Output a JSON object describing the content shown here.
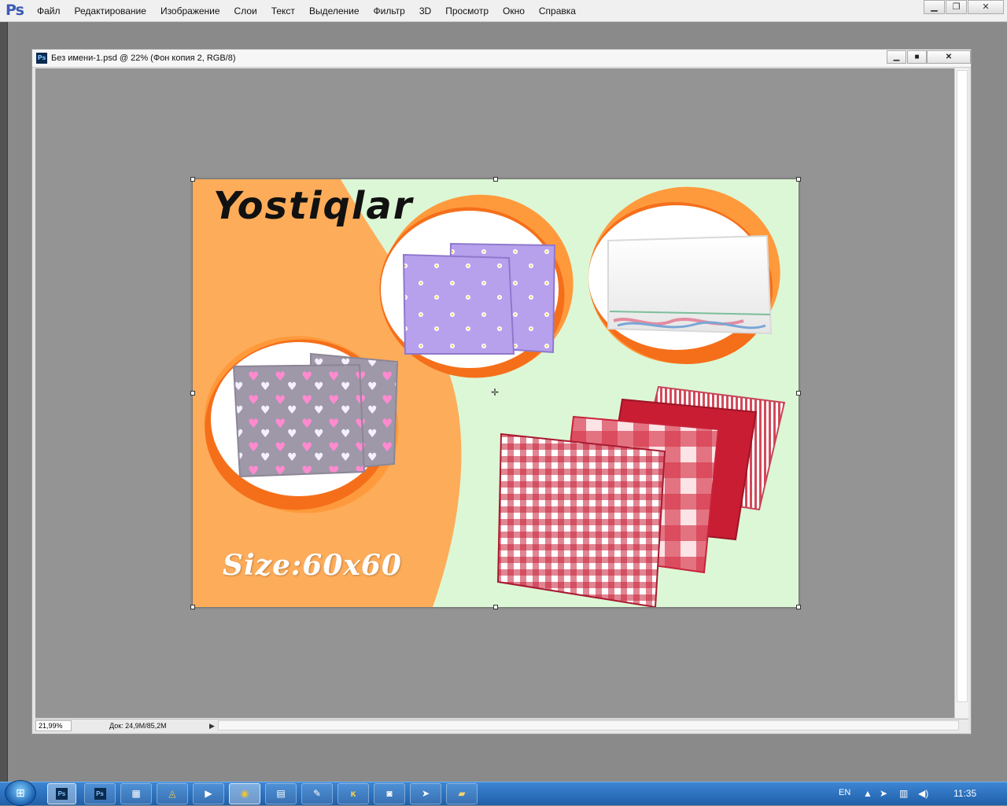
{
  "app": {
    "logo": "Ps",
    "menu": [
      "Файл",
      "Редактирование",
      "Изображение",
      "Слои",
      "Текст",
      "Выделение",
      "Фильтр",
      "3D",
      "Просмотр",
      "Окно",
      "Справка"
    ]
  },
  "document": {
    "icon": "Ps",
    "title": "Без имени-1.psd @ 22% (Фон копия 2, RGB/8)",
    "zoom": "21,99%",
    "doc_info": "Док: 24,9M/85,2M"
  },
  "artwork": {
    "title": "Yostiqlar",
    "size_text": "Size:60x60",
    "colors": {
      "left_bg": "#fdac5a",
      "right_bg": "#dcf7d6",
      "frame_dark": "#f56f1a",
      "frame_light": "#ff9a3c",
      "purple_pillow": "#b8a1ec",
      "gray_pillow": "#9e98a8",
      "red_pillow": "#c81d33"
    }
  },
  "taskbar": {
    "language": "EN",
    "clock": "11:35",
    "buttons": [
      {
        "name": "photoshop-active",
        "icon": "Ps"
      },
      {
        "name": "photoshop-2",
        "icon": "Ps"
      },
      {
        "name": "calculator",
        "icon": "calculator-icon"
      },
      {
        "name": "app-triangle",
        "icon": "triangle-icon"
      },
      {
        "name": "media-player",
        "icon": "play-icon"
      },
      {
        "name": "chrome",
        "icon": "chrome-icon"
      },
      {
        "name": "document-app",
        "icon": "document-icon"
      },
      {
        "name": "paint-app",
        "icon": "paint-icon"
      },
      {
        "name": "ic-app",
        "icon": "ic-icon"
      },
      {
        "name": "camera-app",
        "icon": "camera-icon"
      },
      {
        "name": "telegram",
        "icon": "telegram-icon"
      },
      {
        "name": "explorer",
        "icon": "folder-icon"
      }
    ]
  }
}
